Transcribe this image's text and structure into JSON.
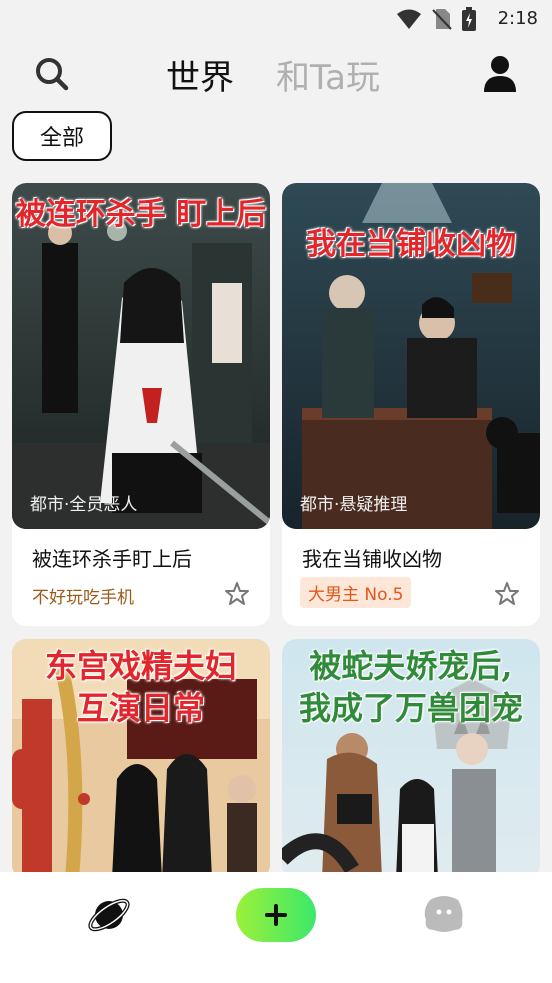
{
  "status": {
    "time": "2:18"
  },
  "header": {
    "tabs": [
      {
        "label": "世界",
        "active": true
      },
      {
        "label": "和Ta玩",
        "active": false
      }
    ]
  },
  "filter": {
    "chip_label": "全部"
  },
  "cards": [
    {
      "cover_title": "被连环杀手 盯上后",
      "genre": "都市·全员恶人",
      "name": "被连环杀手盯上后",
      "tag": "不好玩吃手机",
      "tag_style": "plain"
    },
    {
      "cover_title": "我在当铺收凶物",
      "genre": "都市·悬疑推理",
      "name": "我在当铺收凶物",
      "tag": "大男主 No.5",
      "tag_style": "badge"
    },
    {
      "cover_title_lines": [
        "东宫戏精夫妇",
        "互演日常"
      ]
    },
    {
      "cover_title_lines": [
        "被蛇夫娇宠后,",
        "我成了万兽团宠"
      ]
    }
  ],
  "colors": {
    "accent_green": "#3be86a",
    "cover_title_red": "#e3262b",
    "badge_orange": "#e4571b"
  },
  "icons": [
    "search-icon",
    "profile-icon",
    "star-icon",
    "planet-icon",
    "plus-icon",
    "blob-icon",
    "wifi-icon",
    "no-sim-icon",
    "battery-icon"
  ]
}
